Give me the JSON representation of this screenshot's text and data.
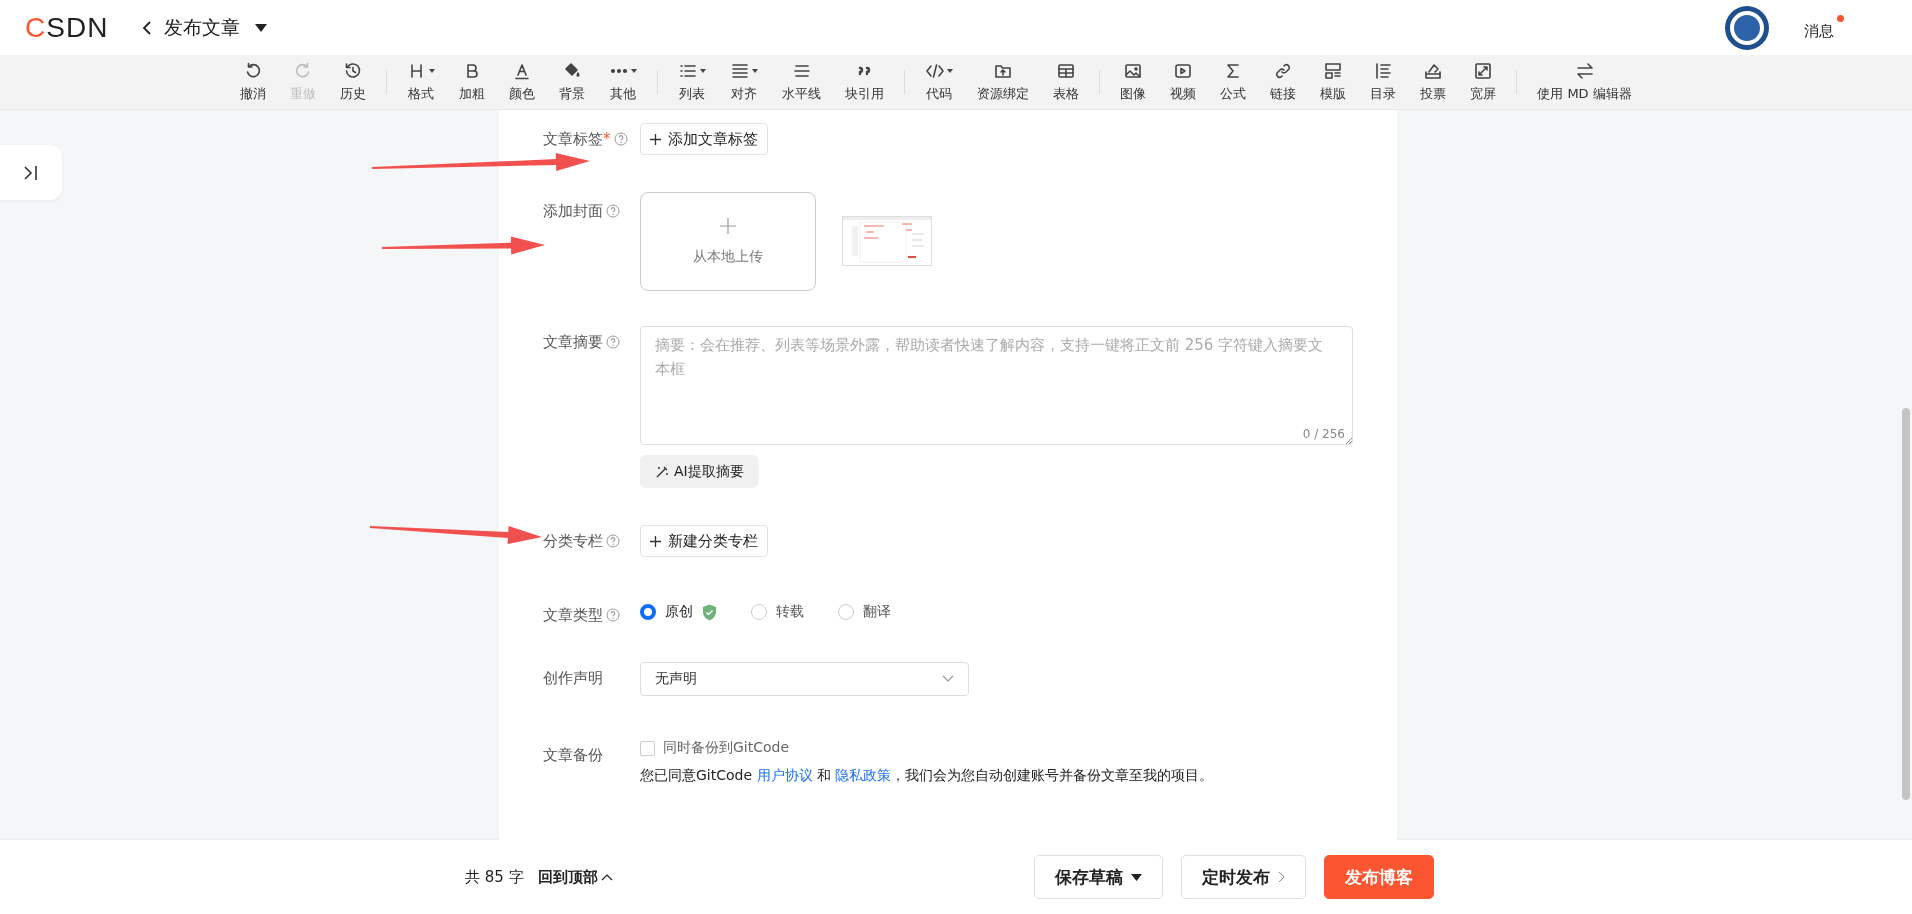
{
  "top_bar": {
    "logo": {
      "accent": "C",
      "rest": "SDN"
    },
    "title": "发布文章",
    "messages": {
      "label": "消息",
      "unread": true
    }
  },
  "toolbar": [
    [
      {
        "label": "撤消",
        "disabled": false,
        "dropdown": false
      },
      {
        "label": "重做",
        "disabled": true,
        "dropdown": false
      },
      {
        "label": "历史",
        "disabled": false,
        "dropdown": false
      }
    ],
    [
      {
        "label": "格式",
        "disabled": false,
        "dropdown": true
      },
      {
        "label": "加粗",
        "disabled": false,
        "dropdown": false
      },
      {
        "label": "颜色",
        "disabled": false,
        "dropdown": false
      },
      {
        "label": "背景",
        "disabled": false,
        "dropdown": false
      },
      {
        "label": "其他",
        "disabled": false,
        "dropdown": true
      }
    ],
    [
      {
        "label": "列表",
        "disabled": false,
        "dropdown": true
      },
      {
        "label": "对齐",
        "disabled": false,
        "dropdown": true
      },
      {
        "label": "水平线",
        "disabled": false,
        "dropdown": false
      },
      {
        "label": "块引用",
        "disabled": false,
        "dropdown": false
      }
    ],
    [
      {
        "label": "代码",
        "disabled": false,
        "dropdown": true
      },
      {
        "label": "资源绑定",
        "disabled": false,
        "dropdown": false
      },
      {
        "label": "表格",
        "disabled": false,
        "dropdown": false
      }
    ],
    [
      {
        "label": "图像",
        "disabled": false,
        "dropdown": false
      },
      {
        "label": "视频",
        "disabled": false,
        "dropdown": false
      },
      {
        "label": "公式",
        "disabled": false,
        "dropdown": false
      },
      {
        "label": "链接",
        "disabled": false,
        "dropdown": false
      },
      {
        "label": "模版",
        "disabled": false,
        "dropdown": false
      },
      {
        "label": "目录",
        "disabled": false,
        "dropdown": false
      },
      {
        "label": "投票",
        "disabled": false,
        "dropdown": false
      },
      {
        "label": "宽屏",
        "disabled": false,
        "dropdown": false
      }
    ],
    [
      {
        "label": "使用 MD 编辑器",
        "disabled": false,
        "dropdown": false
      }
    ]
  ],
  "form": [
    {
      "kind": "tags",
      "label": "文章标签",
      "required_mark": "*",
      "help": true,
      "button": "添加文章标签"
    },
    {
      "kind": "cover",
      "label": "添加封面",
      "help": true,
      "upload": "从本地上传",
      "thumbnail": true
    },
    {
      "kind": "summary",
      "label": "文章摘要",
      "help": true,
      "placeholder": "摘要：会在推荐、列表等场景外露，帮助读者快速了解内容，支持一键将正文前 256 字符键入摘要文本框",
      "counter": "0 / 256",
      "button": "AI提取摘要"
    },
    {
      "kind": "column",
      "label": "分类专栏",
      "help": true,
      "button": "新建分类专栏"
    },
    {
      "kind": "type",
      "label": "文章类型",
      "help": true,
      "options": [
        {
          "label": "原创",
          "selected": true,
          "verified": true
        },
        {
          "label": "转载",
          "selected": false,
          "verified": false
        },
        {
          "label": "翻译",
          "selected": false,
          "verified": false
        }
      ]
    },
    {
      "kind": "declaration",
      "label": "创作声明",
      "help": false,
      "value": "无声明"
    },
    {
      "kind": "backup",
      "label": "文章备份",
      "help": false,
      "checkbox": {
        "label": "同时备份到GitCode",
        "checked": false
      },
      "note": [
        {
          "kind": "text",
          "text": "您已同意GitCode "
        },
        {
          "kind": "link",
          "text": "用户协议"
        },
        {
          "kind": "text",
          "text": " 和 "
        },
        {
          "kind": "link",
          "text": "隐私政策"
        },
        {
          "kind": "text",
          "text": "，我们会为您自动创建账号并备份文章至我的项目。"
        }
      ]
    }
  ],
  "bottom_bar": {
    "word_count": "共 85 字",
    "back_to_top": "回到顶部",
    "buttons": [
      {
        "kind": "draft",
        "label": "保存草稿"
      },
      {
        "kind": "schedule",
        "label": "定时发布"
      },
      {
        "kind": "publish",
        "label": "发布博客"
      }
    ]
  }
}
